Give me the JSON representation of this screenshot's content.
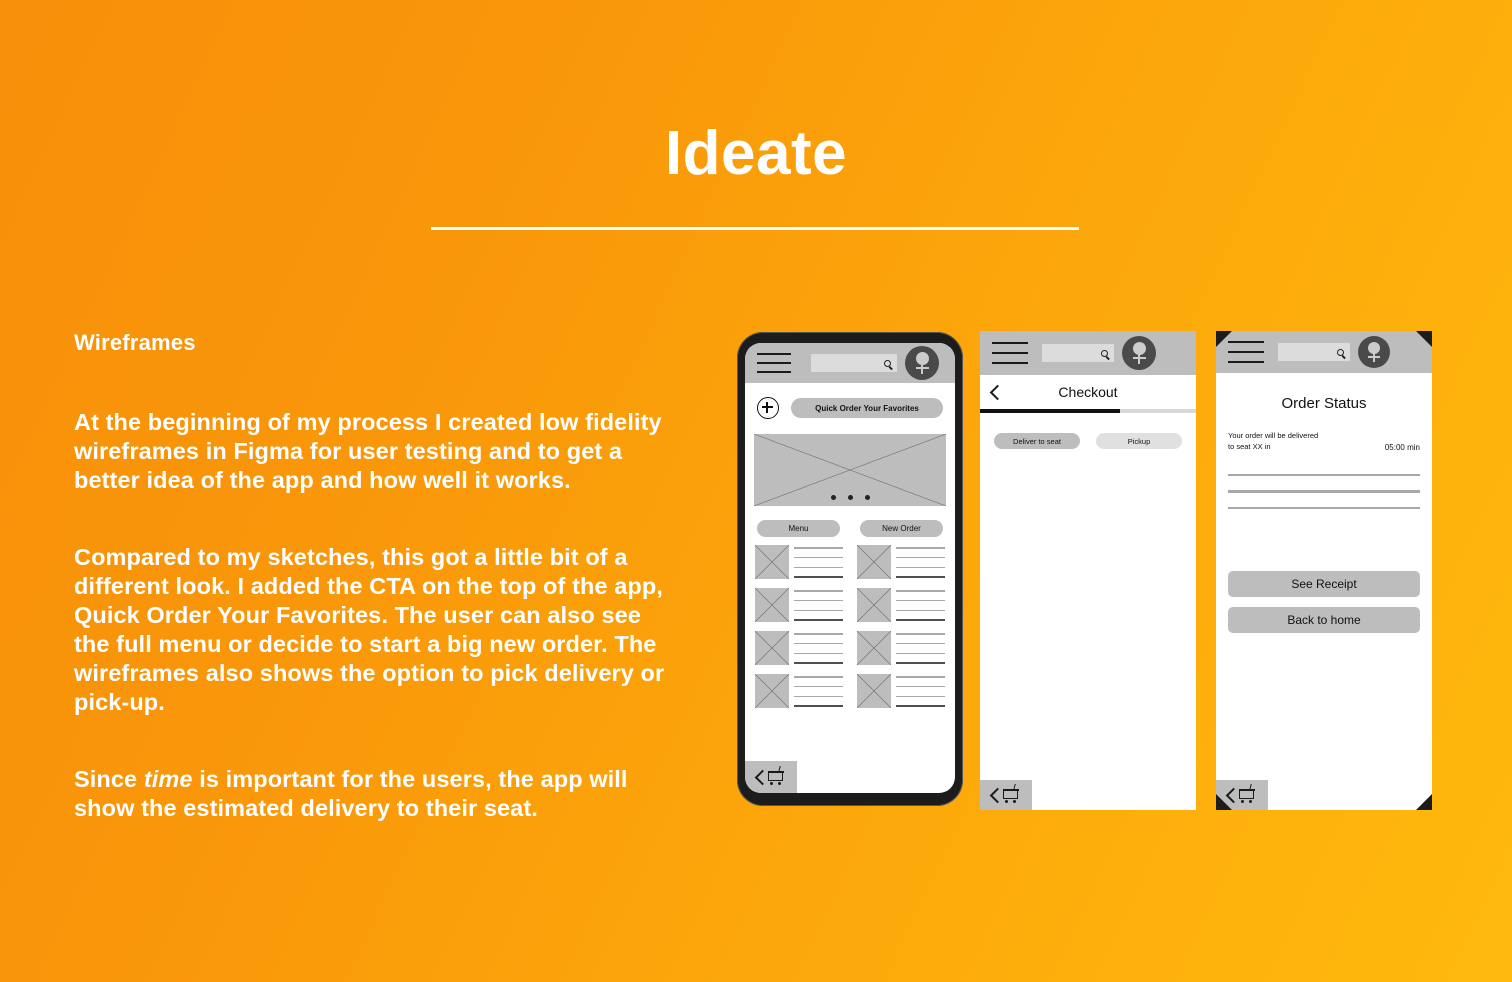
{
  "slide": {
    "title": "Ideate",
    "section_heading": "Wireframes",
    "paragraphs": [
      "At the beginning of my process I created low fidelity wireframes in Figma for user testing and to get a better idea of the app and how well it works.",
      "Compared to my sketches, this got a little bit of a different look. I added the CTA on the top of the app, Quick Order Your Favorites. The user can also see the full menu or decide to start a big new order. The wireframes also shows the option to pick delivery or pick-up.",
      "Since time is important for the users, the app will show the estimated delivery to their seat."
    ],
    "paragraph3": {
      "before": "Since ",
      "italic": "time",
      "after": " is important for the users, the app will show the estimated delivery to their seat."
    }
  },
  "colors": {
    "background_left": "#F7900A",
    "background_right": "#FFB90C",
    "text": "#FFFFFF",
    "wire_gray": "#BDBDBD",
    "wire_light": "#E0E0E0",
    "wire_dark": "#1C1C1C",
    "line_gray": "#A8A8A8"
  },
  "phone1": {
    "name": "Home screen wireframe",
    "appbar": {
      "menu_icon": "hamburger-icon",
      "search_placeholder": "",
      "search_icon": "search-icon",
      "avatar_icon": "user-avatar-icon"
    },
    "add_icon": "plus-circle-icon",
    "cta_label": "Quick Order Your Favorites",
    "carousel": {
      "placeholder_icon": "image-placeholder-icon",
      "dots": 3
    },
    "tabs": [
      {
        "label": "Menu"
      },
      {
        "label": "New Order"
      }
    ],
    "grid_items": [
      {
        "thumb": "image-placeholder-icon",
        "lines": 4
      },
      {
        "thumb": "image-placeholder-icon",
        "lines": 4
      },
      {
        "thumb": "image-placeholder-icon",
        "lines": 4
      },
      {
        "thumb": "image-placeholder-icon",
        "lines": 4
      },
      {
        "thumb": "image-placeholder-icon",
        "lines": 4
      },
      {
        "thumb": "image-placeholder-icon",
        "lines": 4
      },
      {
        "thumb": "image-placeholder-icon",
        "lines": 4
      },
      {
        "thumb": "image-placeholder-icon",
        "lines": 4
      }
    ],
    "bottombar": {
      "back_icon": "chevron-left-icon",
      "cart_icon": "shopping-cart-icon"
    }
  },
  "phone2": {
    "name": "Checkout screen wireframe",
    "appbar": {
      "menu_icon": "hamburger-icon",
      "search_placeholder": "",
      "search_icon": "search-icon",
      "avatar_icon": "user-avatar-icon"
    },
    "back_icon": "chevron-left-icon",
    "title": "Checkout",
    "progress_percent": 65,
    "options": [
      {
        "label": "Deliver to seat",
        "selected": true
      },
      {
        "label": "Pickup",
        "selected": false
      }
    ],
    "bottombar": {
      "back_icon": "chevron-left-icon",
      "cart_icon": "shopping-cart-icon"
    }
  },
  "phone3": {
    "name": "Order status screen wireframe",
    "appbar": {
      "menu_icon": "hamburger-icon",
      "search_placeholder": "",
      "search_icon": "search-icon",
      "avatar_icon": "user-avatar-icon"
    },
    "title": "Order Status",
    "eta_text": "Your order will be delivered\nto seat XX in",
    "eta_line1": "Your order will be delivered",
    "eta_line2": "to seat XX in",
    "eta_time": "05:00 min",
    "detail_lines": 3,
    "buttons": [
      {
        "label": "See Receipt"
      },
      {
        "label": "Back to home"
      }
    ],
    "bottombar": {
      "back_icon": "chevron-left-icon",
      "cart_icon": "shopping-cart-icon"
    }
  }
}
